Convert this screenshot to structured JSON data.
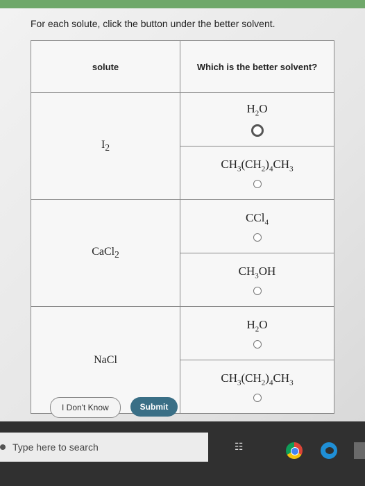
{
  "instruction": "For each solute, click the button under the better solvent.",
  "table": {
    "header_left": "solute",
    "header_right": "Which is the better solvent?",
    "rows": [
      {
        "solute": "I",
        "solute_sub": "2",
        "options": [
          {
            "parts": [
              "H",
              "2",
              "O",
              ""
            ],
            "selected": true
          },
          {
            "parts": [
              "CH",
              "3",
              "(CH",
              "2",
              ")",
              "4",
              "CH",
              "3"
            ],
            "selected": false
          }
        ]
      },
      {
        "solute": "CaCl",
        "solute_sub": "2",
        "options": [
          {
            "parts": [
              "CCl",
              "4"
            ],
            "selected": false
          },
          {
            "parts": [
              "CH",
              "3",
              "OH",
              ""
            ],
            "selected": false
          }
        ]
      },
      {
        "solute": "NaCl",
        "solute_sub": "",
        "options": [
          {
            "parts": [
              "H",
              "2",
              "O",
              ""
            ],
            "selected": false
          },
          {
            "parts": [
              "CH",
              "3",
              "(CH",
              "2",
              ")",
              "4",
              "CH",
              "3"
            ],
            "selected": false
          }
        ]
      }
    ]
  },
  "buttons": {
    "dont_know": "I Don't Know",
    "submit": "Submit"
  },
  "taskbar": {
    "search_placeholder": "Type here to search"
  },
  "colors": {
    "submit_bg": "#3a6f86",
    "top_bar": "#6fa86a"
  }
}
